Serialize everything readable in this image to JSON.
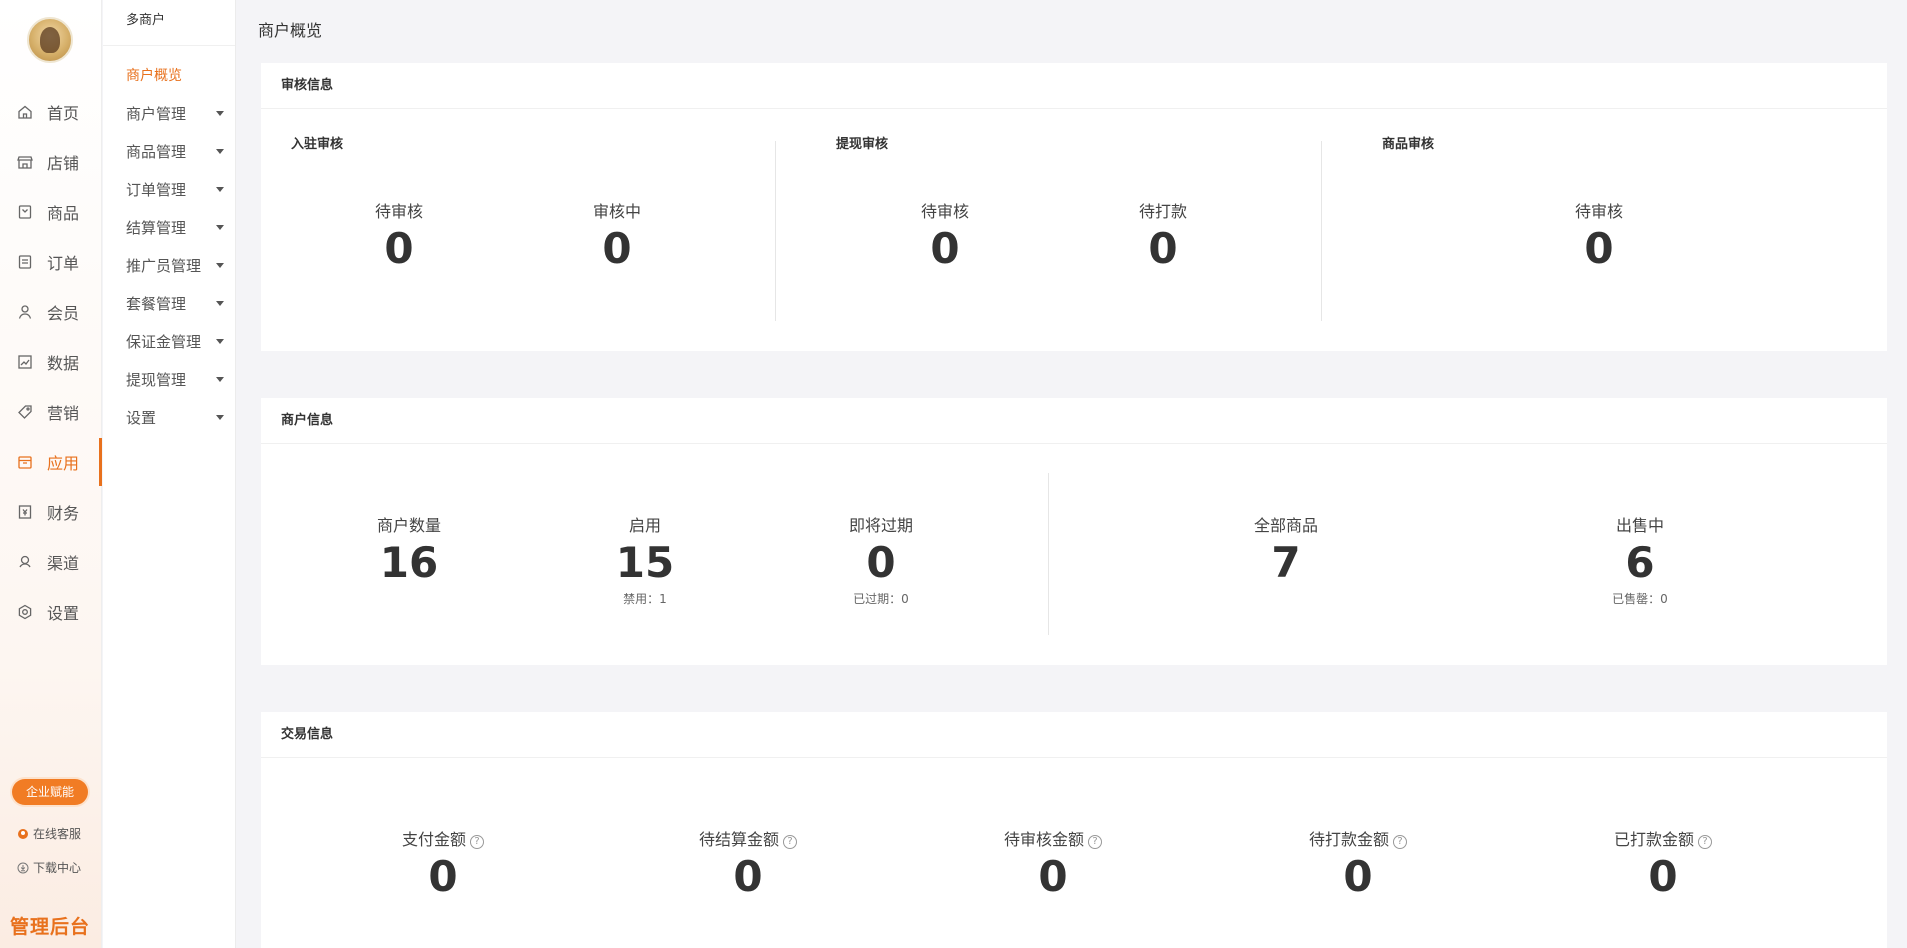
{
  "nav": {
    "items": [
      {
        "label": "首页",
        "icon": "home-icon"
      },
      {
        "label": "店铺",
        "icon": "store-icon"
      },
      {
        "label": "商品",
        "icon": "product-icon"
      },
      {
        "label": "订单",
        "icon": "order-icon"
      },
      {
        "label": "会员",
        "icon": "member-icon"
      },
      {
        "label": "数据",
        "icon": "data-icon"
      },
      {
        "label": "营销",
        "icon": "tag-icon"
      },
      {
        "label": "应用",
        "icon": "app-icon",
        "active": true
      },
      {
        "label": "财务",
        "icon": "finance-icon"
      },
      {
        "label": "渠道",
        "icon": "channel-icon"
      },
      {
        "label": "设置",
        "icon": "gear-icon"
      }
    ],
    "enterprise_button": "企业赋能",
    "online_service": "在线客服",
    "download_center": "下载中心",
    "brand": "管理后台",
    "accent": "#e8711d"
  },
  "submenu": {
    "title": "多商户",
    "items": [
      {
        "label": "商户概览",
        "active": true
      },
      {
        "label": "商户管理"
      },
      {
        "label": "商品管理"
      },
      {
        "label": "订单管理"
      },
      {
        "label": "结算管理"
      },
      {
        "label": "推广员管理"
      },
      {
        "label": "套餐管理"
      },
      {
        "label": "保证金管理"
      },
      {
        "label": "提现管理"
      },
      {
        "label": "设置"
      }
    ]
  },
  "page": {
    "title": "商户概览"
  },
  "audit": {
    "title": "审核信息",
    "sections": [
      {
        "title": "入驻审核",
        "stats": [
          {
            "label": "待审核",
            "value": "0"
          },
          {
            "label": "审核中",
            "value": "0"
          }
        ]
      },
      {
        "title": "提现审核",
        "stats": [
          {
            "label": "待审核",
            "value": "0"
          },
          {
            "label": "待打款",
            "value": "0"
          }
        ]
      },
      {
        "title": "商品审核",
        "stats": [
          {
            "label": "待审核",
            "value": "0"
          }
        ]
      }
    ]
  },
  "merchant": {
    "title": "商户信息",
    "stats": [
      {
        "label": "商户数量",
        "value": "16"
      },
      {
        "label": "启用",
        "value": "15",
        "sub": "禁用：1"
      },
      {
        "label": "即将过期",
        "value": "0",
        "sub": "已过期：0"
      },
      {
        "label": "全部商品",
        "value": "7"
      },
      {
        "label": "出售中",
        "value": "6",
        "sub": "已售罄：0"
      }
    ]
  },
  "trade": {
    "title": "交易信息",
    "stats": [
      {
        "label": "支付金额",
        "value": "0"
      },
      {
        "label": "待结算金额",
        "value": "0"
      },
      {
        "label": "待审核金额",
        "value": "0"
      },
      {
        "label": "待打款金额",
        "value": "0"
      },
      {
        "label": "已打款金额",
        "value": "0"
      }
    ]
  }
}
